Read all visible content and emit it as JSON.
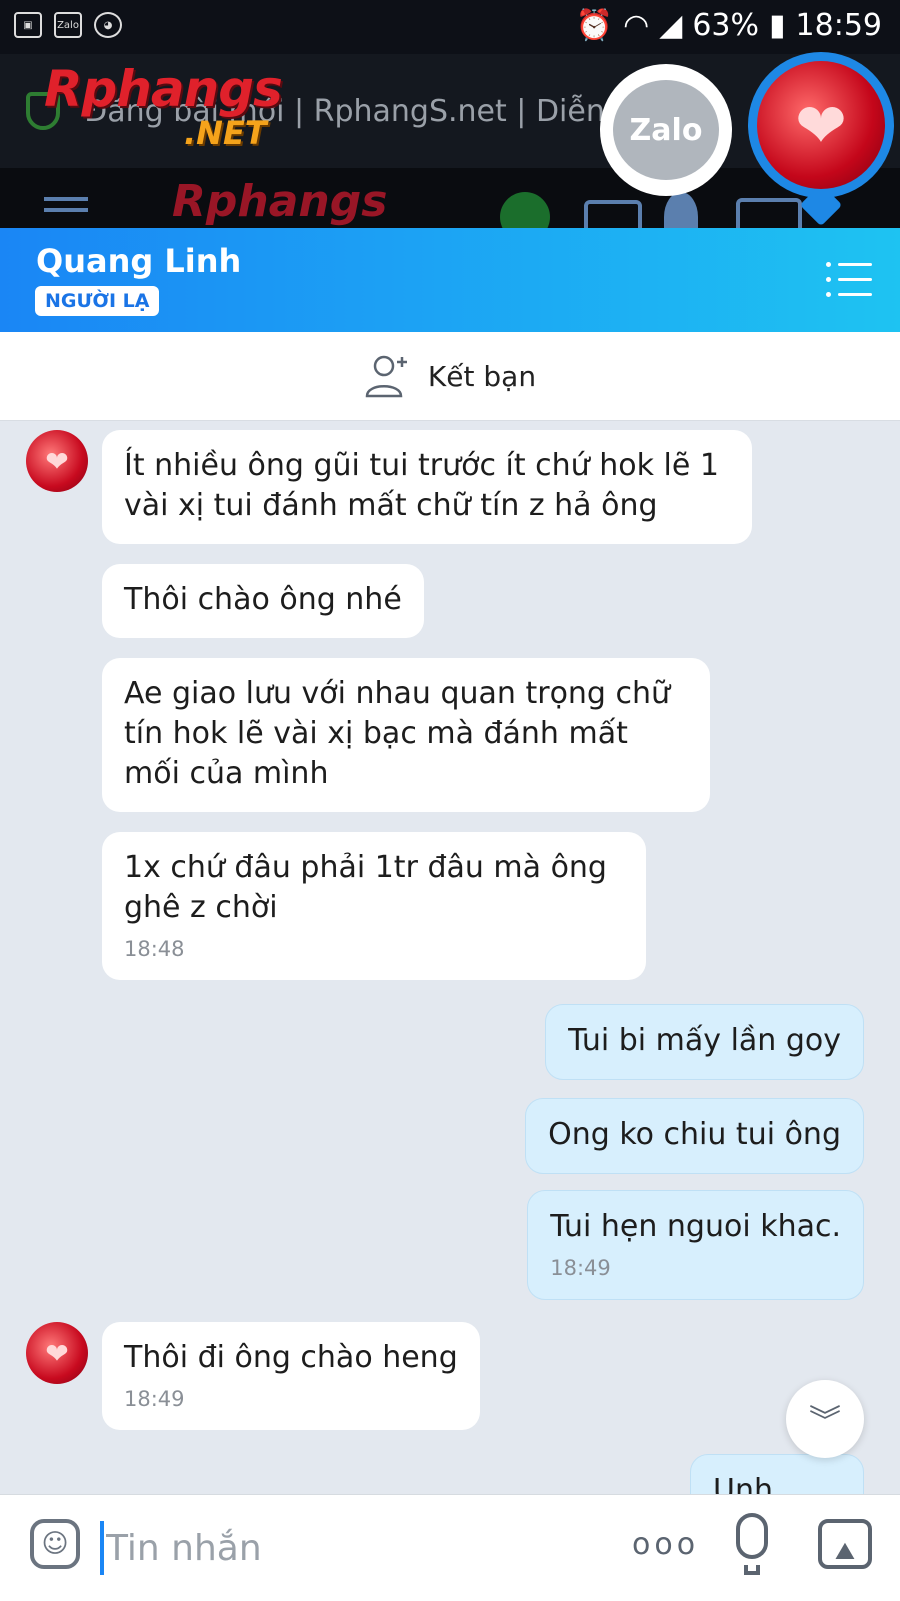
{
  "status_bar": {
    "battery": "63%",
    "time": "18:59",
    "icons": [
      "gallery-icon",
      "zalo-icon",
      "pet-icon",
      "alarm-icon",
      "wifi-icon",
      "signal-icon",
      "battery-icon"
    ]
  },
  "browser": {
    "brand": "Rphangs",
    "brand_suffix": ".NET",
    "tab_title": "Đăng bài mới | RphangS.net | Diễn",
    "forum_brand": "Rphangs"
  },
  "floating_bubbles": {
    "zalo_label": "Zalo"
  },
  "chat_header": {
    "contact_name": "Quang Linh",
    "badge": "NGƯỜI LẠ"
  },
  "add_friend": {
    "label": "Kết bạn"
  },
  "messages": [
    {
      "side": "in",
      "text": "Ít nhiều ông gũi tui trước ít chứ hok lẽ 1 vài xị tui đánh mất chữ tín z hả ông",
      "time": ""
    },
    {
      "side": "in",
      "text": "Thôi chào ông nhé",
      "time": ""
    },
    {
      "side": "in",
      "text": "Ae giao lưu với nhau quan trọng chữ tín hok lẽ vài xị bạc mà đánh mất mối của mình",
      "time": ""
    },
    {
      "side": "in",
      "text": "1x chứ đâu phải 1tr đâu mà ông ghê z chời",
      "time": "18:48"
    },
    {
      "side": "out",
      "text": "Tui bi mấy lần goy",
      "time": ""
    },
    {
      "side": "out",
      "text": "Ong ko chiu tui ông",
      "time": ""
    },
    {
      "side": "out",
      "text": "Tui hẹn nguoi khac.",
      "time": "18:49"
    },
    {
      "side": "in",
      "text": "Thôi đi ông chào heng",
      "time": "18:49"
    },
    {
      "side": "out",
      "text": "Unh",
      "time": ""
    }
  ],
  "input_bar": {
    "placeholder": "Tin nhắn",
    "more_label": "ooo"
  },
  "colors": {
    "header_start": "#1a86f5",
    "header_end": "#1ec3f2",
    "incoming_bubble": "#ffffff",
    "outgoing_bubble": "#d7effd",
    "chat_background": "#e3e8ef"
  }
}
